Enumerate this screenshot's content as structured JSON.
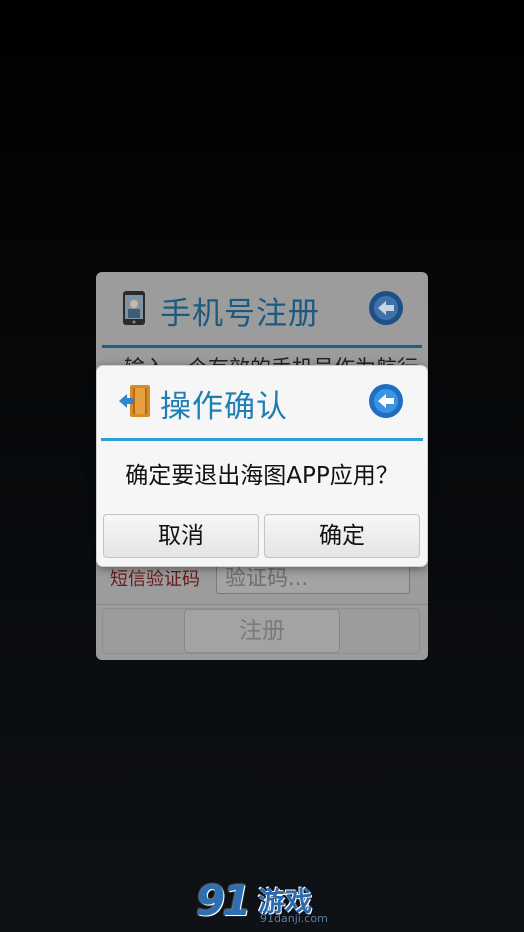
{
  "background_dialog": {
    "title": "手机号注册",
    "hint": "输入一个有效的手机号作为航行",
    "sms_label": "短信验证码",
    "code_placeholder": "验证码...",
    "register_label": "注册"
  },
  "confirm_dialog": {
    "title": "操作确认",
    "message": "确定要退出海图APP应用？",
    "cancel_label": "取消",
    "ok_label": "确定"
  },
  "watermark": {
    "number": "91",
    "word": "游戏",
    "domain": "91danji.com"
  },
  "colors": {
    "accent": "#2d9fd6",
    "title_blue": "#1e7fb4",
    "dim_overlay": "#9c9c9c"
  },
  "icons": [
    "phone-icon",
    "exit-door-icon",
    "back-arrow-icon"
  ]
}
